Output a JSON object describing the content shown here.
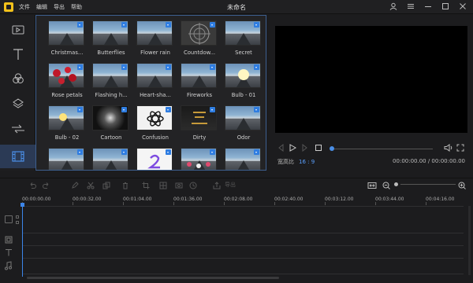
{
  "app": {
    "title": "未命名",
    "menu": [
      "文件",
      "编辑",
      "导出",
      "帮助"
    ]
  },
  "sidebar": {
    "items": [
      {
        "name": "media-tab-icon"
      },
      {
        "name": "text-tab-icon"
      },
      {
        "name": "filters-tab-icon"
      },
      {
        "name": "overlays-tab-icon"
      },
      {
        "name": "transitions-tab-icon"
      },
      {
        "name": "elements-tab-icon",
        "active": true
      }
    ]
  },
  "library": {
    "tiles": [
      {
        "label": "Christmas..."
      },
      {
        "label": "Butterflies"
      },
      {
        "label": "Flower rain"
      },
      {
        "label": "Countdow..."
      },
      {
        "label": "Secret"
      },
      {
        "label": "Rose petals"
      },
      {
        "label": "Flashing h..."
      },
      {
        "label": "Heart-sha..."
      },
      {
        "label": "Fireworks"
      },
      {
        "label": "Bulb - 01"
      },
      {
        "label": "Bulb - 02"
      },
      {
        "label": "Cartoon"
      },
      {
        "label": "Confusion"
      },
      {
        "label": "Dirty"
      },
      {
        "label": "Odor"
      },
      {
        "label": ""
      },
      {
        "label": ""
      },
      {
        "label": ""
      },
      {
        "label": ""
      },
      {
        "label": ""
      }
    ]
  },
  "preview": {
    "ratio_label": "宽高比",
    "ratio_value": "16 : 9",
    "time": "00:00:00.00 / 00:00:00.00"
  },
  "toolbar": {
    "export_label": "导出"
  },
  "timeline": {
    "ticks": [
      "00:00:00.00",
      "00:00:32.00",
      "00:01:04.00",
      "00:01:36.00",
      "00:02:08.00",
      "00:02:40.00",
      "00:03:12.00",
      "00:03:44.00",
      "00:04:16.00"
    ]
  },
  "colors": {
    "accent": "#3c85e8",
    "logo": "#f4c21b",
    "highlight_text": "#5ba0ff"
  }
}
